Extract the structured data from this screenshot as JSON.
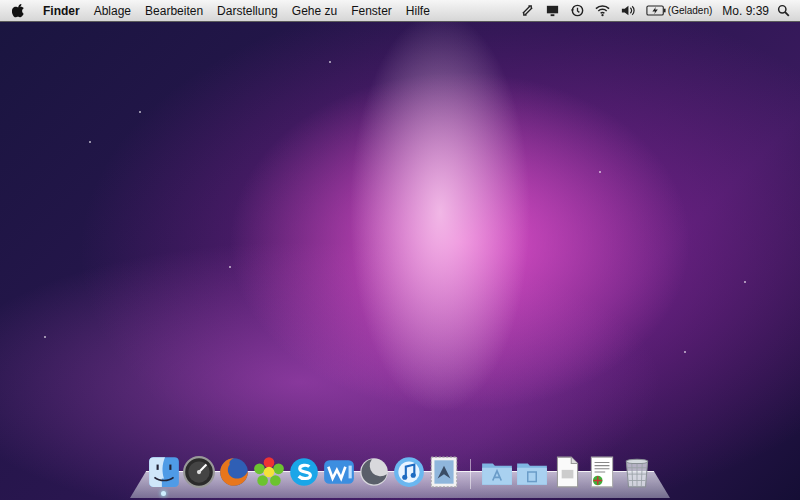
{
  "menubar": {
    "app": "Finder",
    "menus": [
      "Ablage",
      "Bearbeiten",
      "Darstellung",
      "Gehe zu",
      "Fenster",
      "Hilfe"
    ],
    "status_items": [
      {
        "kind": "sync"
      },
      {
        "kind": "display"
      },
      {
        "kind": "time-machine"
      },
      {
        "kind": "wifi"
      },
      {
        "kind": "volume"
      }
    ],
    "battery": {
      "label": "(Geladen)",
      "charging": true
    },
    "clock": "Mo. 9:39"
  },
  "dock": {
    "apps": [
      {
        "kind": "finder",
        "running": true
      },
      {
        "kind": "dashboard",
        "running": false
      },
      {
        "kind": "firefox",
        "running": false
      },
      {
        "kind": "icq",
        "running": false
      },
      {
        "kind": "skype",
        "running": false
      },
      {
        "kind": "wave-app",
        "running": false
      },
      {
        "kind": "moon-app",
        "running": false
      },
      {
        "kind": "itunes",
        "running": false
      },
      {
        "kind": "mail",
        "running": false
      }
    ],
    "stacks": [
      {
        "kind": "applications-folder"
      },
      {
        "kind": "documents-folder"
      },
      {
        "kind": "document"
      },
      {
        "kind": "text-document"
      },
      {
        "kind": "trash"
      }
    ]
  }
}
